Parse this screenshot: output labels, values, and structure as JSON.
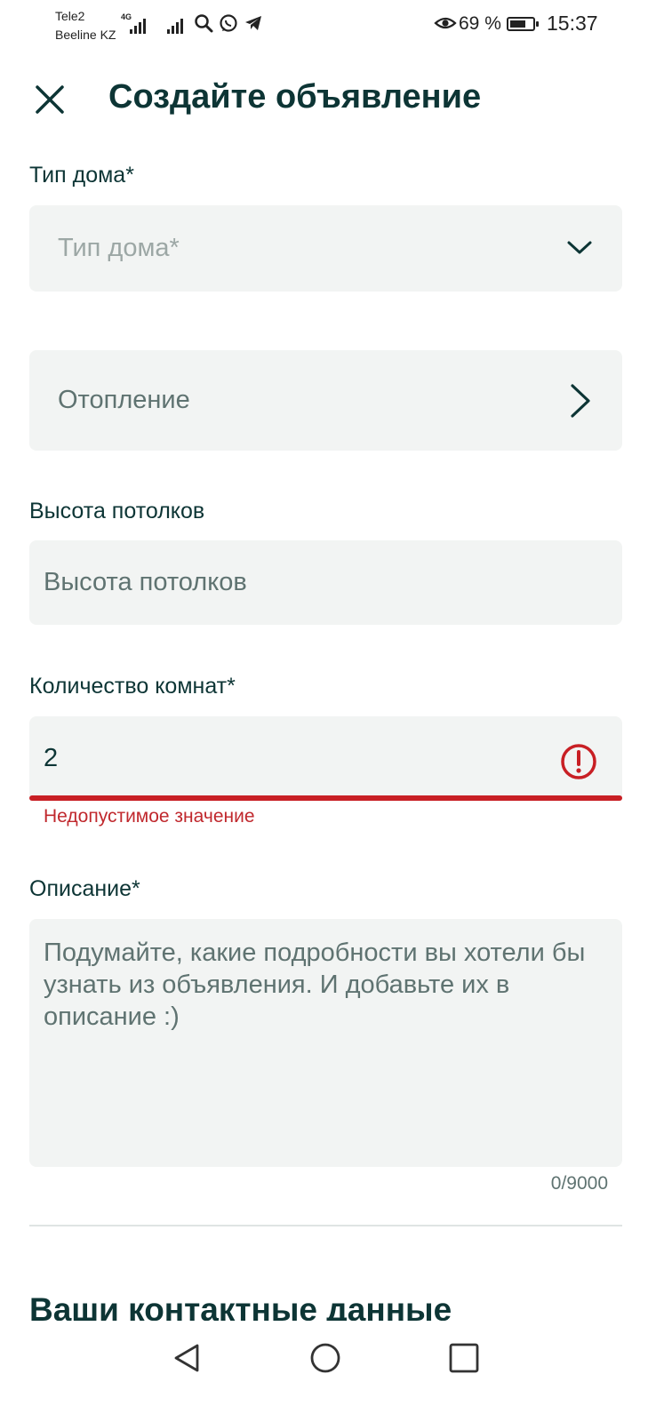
{
  "status_bar": {
    "carrier1": "Tele2",
    "carrier2": "Beeline KZ",
    "network": "4G",
    "battery": "69 %",
    "battery_level": 0.69,
    "time": "15:37",
    "icons": [
      "signal-icon",
      "search-icon",
      "whatsapp-icon",
      "telegram-icon",
      "eye-icon",
      "battery-icon"
    ]
  },
  "header": {
    "title": "Создайте объявление"
  },
  "form": {
    "house_type": {
      "label": "Тип дома*",
      "placeholder": "Тип дома*"
    },
    "heating": {
      "label": "Отопление"
    },
    "ceiling_height": {
      "label": "Высота потолков",
      "placeholder": "Высота потолков"
    },
    "rooms": {
      "label": "Количество комнат*",
      "value": "2",
      "error": "Недопустимое значение"
    },
    "description": {
      "label": "Описание*",
      "placeholder": "Подумайте, какие подробности вы хотели бы узнать из объявления. И добавьте их в описание :)",
      "counter": "0/9000"
    }
  },
  "contacts": {
    "title": "Ваши контактные данные"
  },
  "colors": {
    "text": "#0d3535",
    "field_bg": "#f2f4f3",
    "error": "#c81f24"
  }
}
